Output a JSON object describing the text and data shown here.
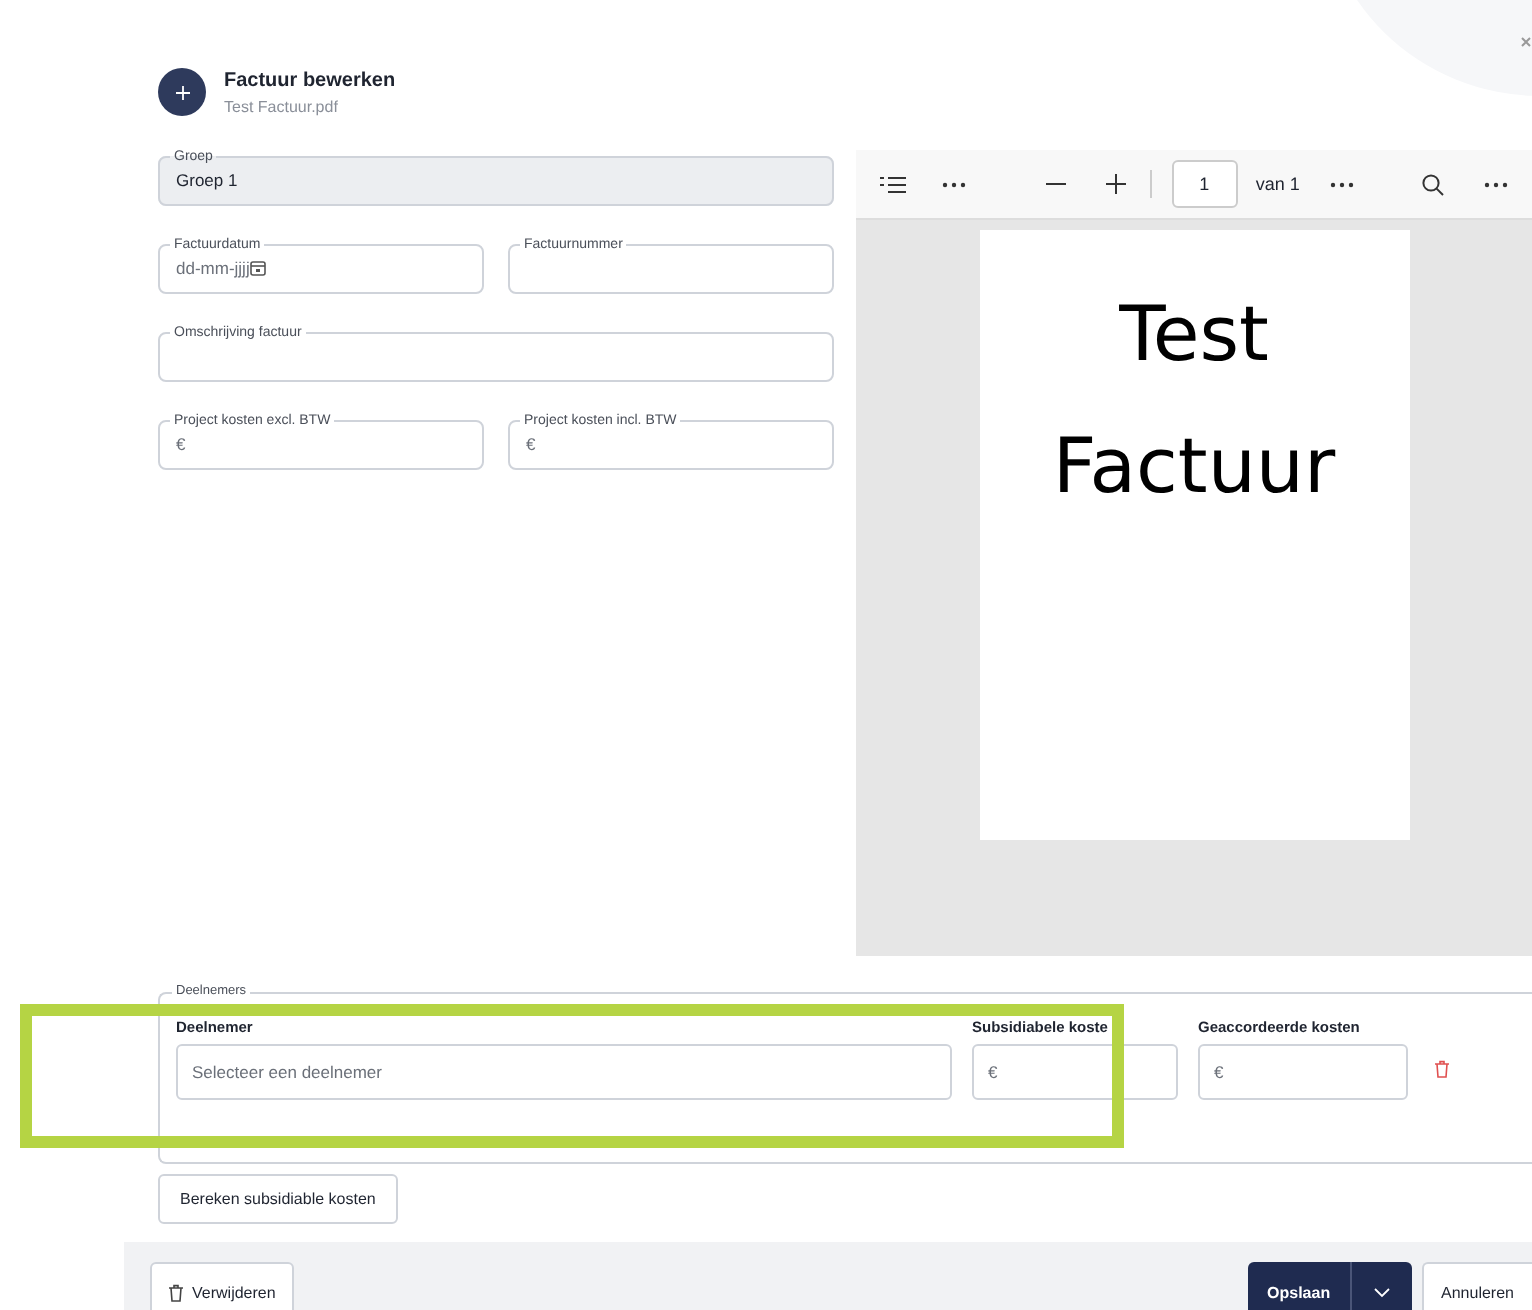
{
  "header": {
    "title": "Factuur bewerken",
    "subtitle": "Test Factuur.pdf"
  },
  "form_rows": [
    [
      {
        "kind": "text",
        "label": "Groep",
        "value": "Groep 1",
        "disabled": true
      }
    ],
    [
      {
        "kind": "date",
        "label": "Factuurdatum",
        "placeholder": "dd-mm-jjjj",
        "disabled": false
      },
      {
        "kind": "text",
        "label": "Factuurnummer",
        "disabled": false
      }
    ],
    [
      {
        "kind": "text",
        "label": "Omschrijving factuur",
        "disabled": false
      }
    ],
    [
      {
        "kind": "text",
        "label": "Project kosten excl. BTW",
        "placeholder": "€",
        "disabled": false
      },
      {
        "kind": "text",
        "label": "Project kosten incl. BTW",
        "placeholder": "€",
        "disabled": false
      }
    ]
  ],
  "pdf_viewer": {
    "page_input": "1",
    "page_count": "van 1",
    "page_text": [
      "Test",
      "Factuur"
    ]
  },
  "participants": {
    "legend": "Deelnemers",
    "columns": [
      "Deelnemer",
      "Subsidiabele koste",
      "Geaccordeerde kosten"
    ],
    "row": {
      "participant_placeholder": "Selecteer een deelnemer",
      "subsidy_placeholder": "€",
      "approved_placeholder": "€"
    }
  },
  "calculate_button": "Bereken subsidiable kosten",
  "footer": {
    "delete_button": "Verwijderen",
    "save_button": "Opslaan",
    "cancel_button": "Annuleren"
  }
}
